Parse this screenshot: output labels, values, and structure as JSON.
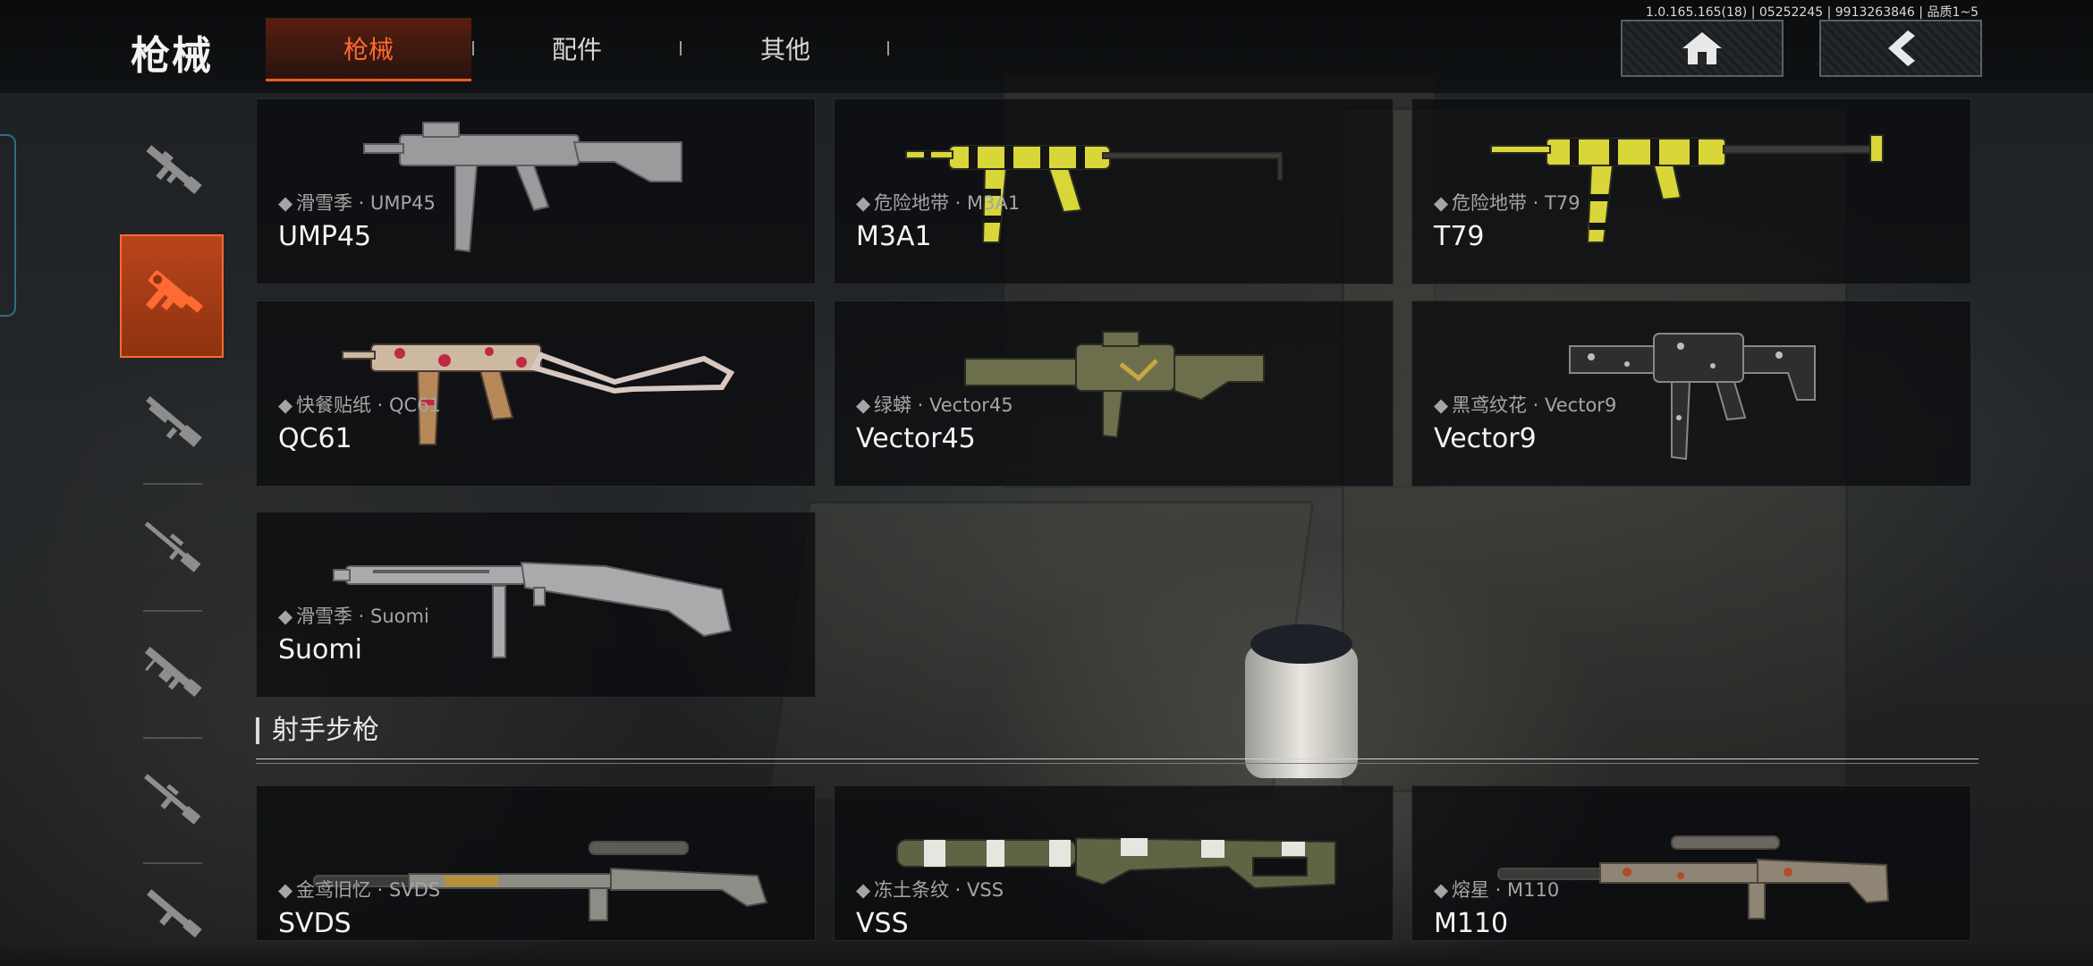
{
  "header": {
    "title": "枪械",
    "tabs": [
      {
        "label": "枪械",
        "active": true
      },
      {
        "label": "配件",
        "active": false
      },
      {
        "label": "其他",
        "active": false
      }
    ],
    "version": "1.0.165.165(18) | 05252245 | 9913263846 | 品质1~5",
    "home_icon": "home-icon",
    "back_icon": "chevron-left-icon"
  },
  "sidebar": {
    "categories": [
      {
        "icon": "assault-rifle-icon",
        "active": false
      },
      {
        "icon": "submachine-gun-icon",
        "active": true
      },
      {
        "icon": "shotgun-icon",
        "active": false
      },
      {
        "icon": "sniper-rifle-icon",
        "active": false
      },
      {
        "icon": "light-machine-gun-icon",
        "active": false
      },
      {
        "icon": "marksman-rifle-icon",
        "active": false
      },
      {
        "icon": "pistol-icon",
        "active": false
      }
    ]
  },
  "weapons": [
    {
      "skin": "滑雪季 · UMP45",
      "name": "UMP45"
    },
    {
      "skin": "危险地带 · M3A1",
      "name": "M3A1"
    },
    {
      "skin": "危险地带 · T79",
      "name": "T79"
    },
    {
      "skin": "快餐贴纸 · QC61",
      "name": "QC61"
    },
    {
      "skin": "绿蟒 · Vector45",
      "name": "Vector45"
    },
    {
      "skin": "黑鸢纹花 · Vector9",
      "name": "Vector9"
    },
    {
      "skin": "滑雪季 · Suomi",
      "name": "Suomi"
    }
  ],
  "marksman_section": {
    "title": "射手步枪",
    "weapons": [
      {
        "skin": "金鸢旧忆 · SVDS",
        "name": "SVDS"
      },
      {
        "skin": "冻土条纹 · VSS",
        "name": "VSS"
      },
      {
        "skin": "熔星 · M110",
        "name": "M110"
      }
    ]
  },
  "colors": {
    "accent": "#ff5a1f",
    "accent_dark": "#8f3210"
  }
}
